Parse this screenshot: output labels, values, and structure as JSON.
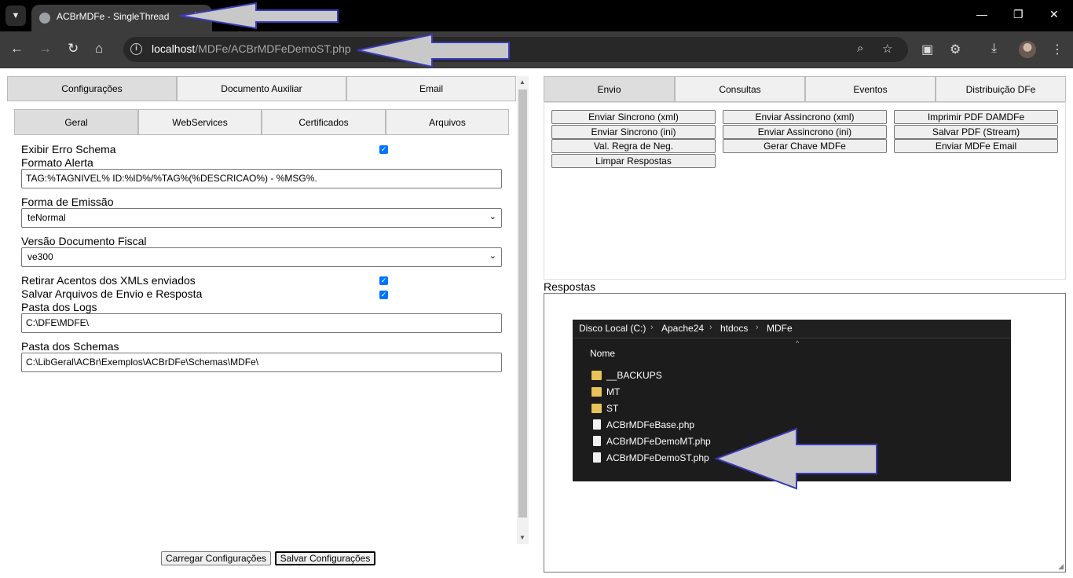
{
  "browser": {
    "tab_title": "ACBrMDFe - SingleThread",
    "tab_close": "✕",
    "new_tab": "+",
    "search_tabs_icon": "chevron-down-icon",
    "win_minimize": "—",
    "win_restore": "❐",
    "win_close": "✕",
    "back": "←",
    "forward": "→",
    "reload": "↻",
    "home": "⌂",
    "url_host": "localhost",
    "url_path": "/MDFe/ACBrMDFeDemoST.php",
    "info": "i",
    "zoom": "⌕",
    "star": "☆",
    "ext1": "▣",
    "ext2": "⚙",
    "download": "⤓",
    "menu": "⋮"
  },
  "left": {
    "main_tabs": [
      "Configurações",
      "Documento Auxiliar",
      "Email"
    ],
    "sub_tabs": [
      "Geral",
      "WebServices",
      "Certificados",
      "Arquivos"
    ],
    "exibir_erro_schema": "Exibir Erro Schema",
    "formato_alerta_label": "Formato Alerta",
    "formato_alerta_value": "TAG:%TAGNIVEL% ID:%ID%/%TAG%(%DESCRICAO%) - %MSG%.",
    "forma_emissao_label": "Forma de Emissão",
    "forma_emissao_value": "teNormal",
    "versao_label": "Versão Documento Fiscal",
    "versao_value": "ve300",
    "retirar_acentos": "Retirar Acentos dos XMLs enviados",
    "salvar_arquivos": "Salvar Arquivos de Envio e Resposta",
    "pasta_logs_label": "Pasta dos Logs",
    "pasta_logs_value": "C:\\DFE\\MDFE\\",
    "pasta_schemas_label": "Pasta dos Schemas",
    "pasta_schemas_value": "C:\\LibGeral\\ACBr\\Exemplos\\ACBrDFe\\Schemas\\MDFe\\",
    "carregar_btn": "Carregar Configurações",
    "salvar_btn": "Salvar Configurações",
    "chevron": "⌄",
    "check": "✓"
  },
  "right": {
    "tabs": [
      "Envio",
      "Consultas",
      "Eventos",
      "Distribuição DFe"
    ],
    "buttons": [
      "Enviar Sincrono (xml)",
      "Enviar Assincrono (xml)",
      "Imprimir PDF DAMDFe",
      "Enviar Sincrono (ini)",
      "Enviar Assincrono (ini)",
      "Salvar PDF (Stream)",
      "Val. Regra de Neg.",
      "Gerar Chave MDFe",
      "Enviar MDFe Email",
      "Limpar Respostas"
    ],
    "respostas_label": "Respostas"
  },
  "explorer": {
    "breadcrumb": [
      "Disco Local (C:)",
      "Apache24",
      "htdocs",
      "MDFe"
    ],
    "crumb_sep": "›",
    "column_header": "Nome",
    "sort_indicator": "^",
    "items": [
      {
        "name": "__BACKUPS",
        "kind": "folder"
      },
      {
        "name": "MT",
        "kind": "folder"
      },
      {
        "name": "ST",
        "kind": "folder"
      },
      {
        "name": "ACBrMDFeBase.php",
        "kind": "file"
      },
      {
        "name": "ACBrMDFeDemoMT.php",
        "kind": "file"
      },
      {
        "name": "ACBrMDFeDemoST.php",
        "kind": "file"
      }
    ]
  },
  "colors": {
    "annotation_arrow_fill": "#c8c8c8",
    "annotation_arrow_stroke": "#3a3ab8",
    "checkbox": "#0075ff",
    "folder": "#e8c25a"
  }
}
